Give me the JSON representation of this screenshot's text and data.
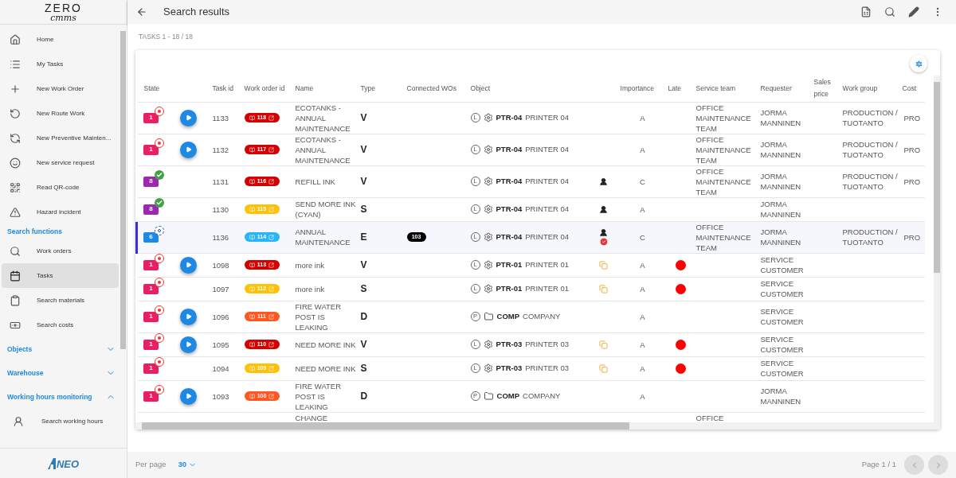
{
  "sidebar": {
    "logo": {
      "top": "ZERO",
      "bottom": "cmms"
    },
    "items": [
      {
        "kind": "link",
        "label": "Home",
        "selected": false
      },
      {
        "kind": "link",
        "label": "My Tasks",
        "selected": false
      },
      {
        "kind": "link",
        "label": "New Work Order",
        "selected": false
      },
      {
        "kind": "link",
        "label": "New Route Work",
        "selected": false
      },
      {
        "kind": "link",
        "label": "New Preventive Mainten...",
        "selected": false
      },
      {
        "kind": "link",
        "label": "New service request",
        "selected": false
      },
      {
        "kind": "link",
        "label": "Read QR-code",
        "selected": false
      },
      {
        "kind": "link",
        "label": "Hazard incident",
        "selected": false
      },
      {
        "kind": "section",
        "label": "Search functions",
        "children": [
          {
            "label": "Work orders",
            "selected": false
          },
          {
            "label": "Tasks",
            "selected": true
          },
          {
            "label": "Search materials",
            "selected": false
          },
          {
            "label": "Search costs",
            "selected": false
          }
        ]
      },
      {
        "kind": "group",
        "label": "Objects",
        "expanded": false
      },
      {
        "kind": "group",
        "label": "Warehouse",
        "expanded": false
      },
      {
        "kind": "group",
        "label": "Working hours monitoring",
        "expanded": true,
        "children": [
          {
            "label": "Search working hours",
            "selected": false
          }
        ]
      }
    ],
    "footer_logo": "NEO"
  },
  "topbar": {
    "title": "Search results"
  },
  "count": "TASKS 1 - 18 / 18",
  "table": {
    "columns": [
      "State",
      "Task id",
      "Work order id",
      "Name",
      "Type",
      "Connected WOs",
      "Object",
      "Importance",
      "Late",
      "Service team",
      "Requester",
      "Sales price",
      "Work group",
      "Cost"
    ],
    "rows": [
      {
        "selected": false,
        "state": {
          "label": "1",
          "color": "#e91e63",
          "kind": "stopped"
        },
        "play": true,
        "task_id": "1133",
        "work_order": {
          "label": "118",
          "color": "#d50000"
        },
        "name": "ECOTANKS - ANNUAL MAINTENANCE",
        "type": "V",
        "object": {
          "scope": "L",
          "kind": "device",
          "code": "PTR-04",
          "name": "PRINTER 04"
        },
        "importance": "A",
        "late": false,
        "service_team": "OFFICE MAINTENANCE TEAM",
        "requester": "JORMA MANNINEN",
        "work_group": "PRODUCTION / TUOTANTO",
        "cost": "PRO"
      },
      {
        "selected": false,
        "state": {
          "label": "1",
          "color": "#e91e63",
          "kind": "stopped"
        },
        "play": true,
        "task_id": "1132",
        "work_order": {
          "label": "117",
          "color": "#d50000"
        },
        "name": "ECOTANKS - ANNUAL MAINTENANCE",
        "type": "V",
        "object": {
          "scope": "L",
          "kind": "device",
          "code": "PTR-04",
          "name": "PRINTER 04"
        },
        "importance": "A",
        "late": false,
        "service_team": "OFFICE MAINTENANCE TEAM",
        "requester": "JORMA MANNINEN",
        "work_group": "PRODUCTION / TUOTANTO",
        "cost": "PRO"
      },
      {
        "selected": false,
        "state": {
          "label": "8",
          "color": "#9c27b0",
          "kind": "done"
        },
        "play": false,
        "task_id": "1131",
        "work_order": {
          "label": "116",
          "color": "#d50000"
        },
        "name": "REFILL INK",
        "type": "V",
        "object": {
          "scope": "L",
          "kind": "device",
          "code": "PTR-04",
          "name": "PRINTER 04"
        },
        "indicator": {
          "kind": "person"
        },
        "importance": "C",
        "late": false,
        "service_team": "OFFICE MAINTENANCE TEAM",
        "requester": "JORMA MANNINEN",
        "work_group": "PRODUCTION / TUOTANTO",
        "cost": "PRO"
      },
      {
        "selected": false,
        "state": {
          "label": "8",
          "color": "#9c27b0",
          "kind": "done"
        },
        "play": false,
        "task_id": "1130",
        "work_order": {
          "label": "115",
          "color": "#ffc107"
        },
        "name": "SEND MORE INK (CYAN)",
        "type": "S",
        "object": {
          "scope": "L",
          "kind": "device",
          "code": "PTR-04",
          "name": "PRINTER 04"
        },
        "indicator": {
          "kind": "person"
        },
        "importance": "A",
        "late": false,
        "requester": "JORMA MANNINEN"
      },
      {
        "selected": true,
        "state": {
          "label": "6",
          "color": "#1e88e5",
          "kind": "progress"
        },
        "play": false,
        "task_id": "1136",
        "work_order": {
          "label": "114",
          "color": "#29b6f6"
        },
        "name": "ANNUAL MAINTENANCE",
        "type": "E",
        "connected": "103",
        "object": {
          "scope": "L",
          "kind": "device",
          "code": "PTR-04",
          "name": "PRINTER 04"
        },
        "indicator": {
          "kind": "person_check"
        },
        "importance": "C",
        "late": false,
        "service_team": "OFFICE MAINTENANCE TEAM",
        "requester": "JORMA MANNINEN",
        "work_group": "PRODUCTION / TUOTANTO",
        "cost": "PRO"
      },
      {
        "selected": false,
        "state": {
          "label": "1",
          "color": "#e91e63",
          "kind": "stopped"
        },
        "play": true,
        "task_id": "1098",
        "work_order": {
          "label": "113",
          "color": "#d50000"
        },
        "name": "more ink",
        "type": "V",
        "object": {
          "scope": "L",
          "kind": "device",
          "code": "PTR-01",
          "name": "PRINTER 01"
        },
        "indicator": {
          "kind": "copy"
        },
        "importance": "A",
        "late": true,
        "requester": "SERVICE CUSTOMER"
      },
      {
        "selected": false,
        "state": {
          "label": "1",
          "color": "#e91e63",
          "kind": "stopped"
        },
        "play": false,
        "task_id": "1097",
        "work_order": {
          "label": "112",
          "color": "#ffc107"
        },
        "name": "more ink",
        "type": "S",
        "object": {
          "scope": "L",
          "kind": "device",
          "code": "PTR-01",
          "name": "PRINTER 01"
        },
        "indicator": {
          "kind": "copy"
        },
        "importance": "A",
        "late": true,
        "requester": "SERVICE CUSTOMER"
      },
      {
        "selected": false,
        "state": {
          "label": "1",
          "color": "#e91e63",
          "kind": "stopped"
        },
        "play": true,
        "task_id": "1096",
        "work_order": {
          "label": "111",
          "color": "#ff5722"
        },
        "name": "FIRE WATER POST IS LEAKING",
        "type": "D",
        "object": {
          "scope": "P",
          "kind": "folder",
          "code": "COMP",
          "name": "COMPANY"
        },
        "importance": "A",
        "late": false,
        "requester": "SERVICE CUSTOMER"
      },
      {
        "selected": false,
        "state": {
          "label": "1",
          "color": "#e91e63",
          "kind": "stopped"
        },
        "play": true,
        "task_id": "1095",
        "work_order": {
          "label": "110",
          "color": "#d50000"
        },
        "name": "NEED MORE INK",
        "type": "V",
        "object": {
          "scope": "L",
          "kind": "device",
          "code": "PTR-03",
          "name": "PRINTER 03"
        },
        "indicator": {
          "kind": "copy"
        },
        "importance": "A",
        "late": true,
        "requester": "SERVICE CUSTOMER"
      },
      {
        "selected": false,
        "state": {
          "label": "1",
          "color": "#e91e63",
          "kind": "stopped"
        },
        "play": false,
        "task_id": "1094",
        "work_order": {
          "label": "109",
          "color": "#ffc107"
        },
        "name": "NEED MORE INK",
        "type": "S",
        "object": {
          "scope": "L",
          "kind": "device",
          "code": "PTR-03",
          "name": "PRINTER 03"
        },
        "indicator": {
          "kind": "copy"
        },
        "importance": "A",
        "late": true,
        "requester": "SERVICE CUSTOMER"
      },
      {
        "selected": false,
        "state": {
          "label": "1",
          "color": "#e91e63",
          "kind": "stopped"
        },
        "play": true,
        "task_id": "1093",
        "work_order": {
          "label": "108",
          "color": "#ff5722"
        },
        "name": "FIRE WATER POST IS LEAKING",
        "type": "D",
        "object": {
          "scope": "P",
          "kind": "folder",
          "code": "COMP",
          "name": "COMPANY"
        },
        "importance": "A",
        "late": false,
        "requester": "JORMA MANNINEN"
      }
    ],
    "partial_row": {
      "name": "CHANGE",
      "service_team": "OFFICE"
    }
  },
  "footer": {
    "per_page_label": "Per page",
    "per_page": "30",
    "page": "Page 1 / 1"
  }
}
